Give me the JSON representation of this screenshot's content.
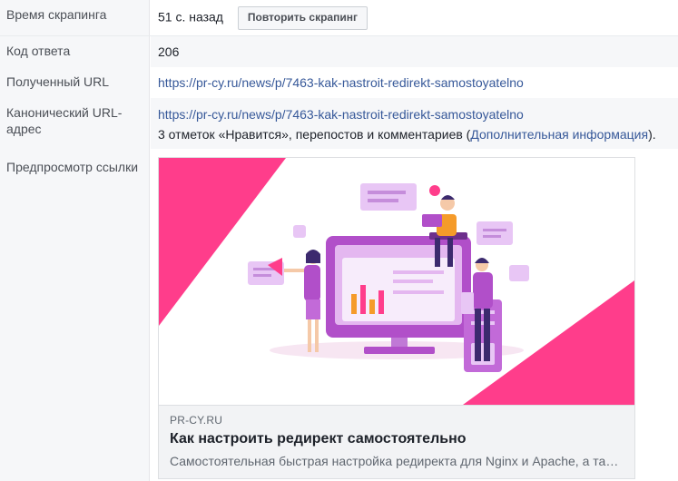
{
  "rows": {
    "scrape_time": {
      "label": "Время скрапинга",
      "value": "51 с. назад",
      "button": "Повторить скрапинг"
    },
    "response_code": {
      "label": "Код ответа",
      "value": "206"
    },
    "fetched_url": {
      "label": "Полученный URL",
      "value": "https://pr-cy.ru/news/p/7463-kak-nastroit-redirekt-samostoyatelno"
    },
    "canonical_url": {
      "label": "Канонический URL-адрес",
      "value": "https://pr-cy.ru/news/p/7463-kak-nastroit-redirekt-samostoyatelno",
      "likes_prefix": "3 отметок «Нравится», перепостов и комментариев (",
      "likes_link": "Дополнительная информация",
      "likes_suffix": ")."
    },
    "link_preview": {
      "label": "Предпросмотр ссылки"
    }
  },
  "preview": {
    "domain": "PR-CY.RU",
    "title": "Как настроить редирект самостоятельно",
    "description": "Самостоятельная быстрая настройка редиректа для Nginx и Apache, а также проверка его работы."
  },
  "colors": {
    "accent": "#ff3d8b",
    "purple": "#b14fc9",
    "link": "#365899"
  }
}
